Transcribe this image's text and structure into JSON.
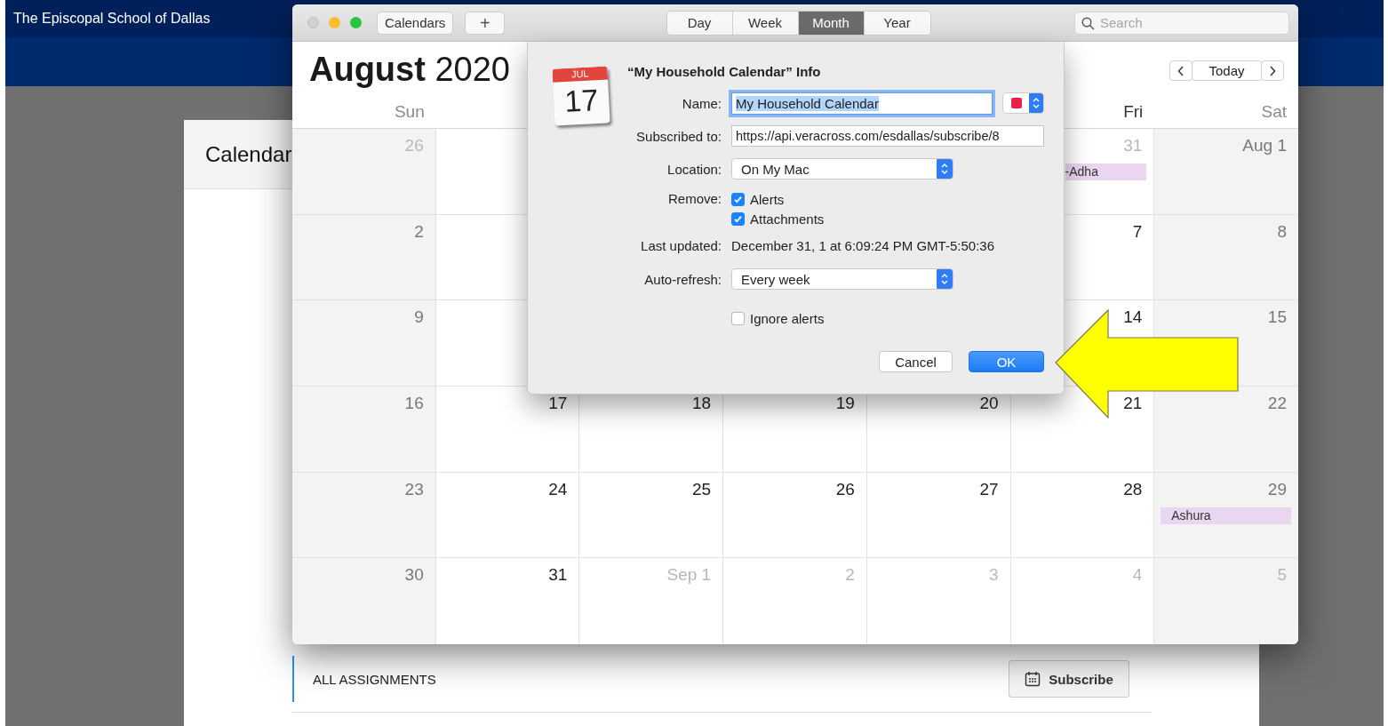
{
  "site": {
    "title": "The Episcopal School of Dallas",
    "card_title": "Calendar",
    "section_label": "ALL ASSIGNMENTS",
    "subscribe_button": "Subscribe"
  },
  "calendar_window": {
    "toolbar": {
      "calendars_button": "Calendars",
      "add_button": "+",
      "views": [
        {
          "label": "Day",
          "selected": false
        },
        {
          "label": "Week",
          "selected": false
        },
        {
          "label": "Month",
          "selected": true
        },
        {
          "label": "Year",
          "selected": false
        }
      ],
      "search": {
        "placeholder": "Search"
      }
    },
    "title": "**August** 2020",
    "today_button": "Today",
    "day_headers": {
      "start": [
        "Sun"
      ],
      "end": [
        "Fri",
        "Sat"
      ]
    },
    "weeks": [
      {
        "start": [
          {
            "label": "26",
            "other_month": true
          }
        ],
        "end": [
          {
            "label": "31",
            "other_month": true,
            "events": [
              "-Adha"
            ]
          },
          {
            "label": "Aug 1",
            "other_month": false
          }
        ]
      },
      {
        "start": [
          {
            "label": "2",
            "other_month": false
          }
        ],
        "end": [
          {
            "label": "7",
            "other_month": false
          },
          {
            "label": "8",
            "other_month": false
          }
        ]
      },
      {
        "start": [
          {
            "label": "9",
            "other_month": false
          }
        ],
        "end": [
          {
            "label": "14",
            "other_month": false
          },
          {
            "label": "15",
            "other_month": false
          }
        ]
      },
      {
        "start": [
          {
            "label": "16",
            "other_month": false
          },
          {
            "label": "17",
            "other_month": false
          },
          {
            "label": "18",
            "other_month": false
          },
          {
            "label": "19",
            "other_month": false
          },
          {
            "label": "20",
            "other_month": false
          },
          {
            "label": "21",
            "other_month": false
          },
          {
            "label": "22",
            "other_month": false
          }
        ]
      },
      {
        "start": [
          {
            "label": "23",
            "other_month": false
          },
          {
            "label": "24",
            "other_month": false
          },
          {
            "label": "25",
            "other_month": false
          },
          {
            "label": "26",
            "other_month": false
          },
          {
            "label": "27",
            "other_month": false
          },
          {
            "label": "28",
            "other_month": false
          },
          {
            "label": "29",
            "other_month": false,
            "events": [
              "Ashura"
            ]
          }
        ]
      },
      {
        "start": [
          {
            "label": "30",
            "other_month": false
          },
          {
            "label": "31",
            "other_month": false
          },
          {
            "label": "Sep 1",
            "other_month": true
          },
          {
            "label": "2",
            "other_month": true
          },
          {
            "label": "3",
            "other_month": true
          },
          {
            "label": "4",
            "other_month": true
          },
          {
            "label": "5",
            "other_month": true
          }
        ]
      }
    ]
  },
  "dialog": {
    "icon": {
      "month": "JUL",
      "day": "17"
    },
    "title": "“My Household Calendar” Info",
    "name": {
      "label": "Name:",
      "value": "My Household Calendar",
      "text_selected": true,
      "color": "#e8234a"
    },
    "subscribed": {
      "label": "Subscribed to:",
      "value": "https://api.veracross.com/esdallas/subscribe/8"
    },
    "location": {
      "label": "Location:",
      "value": "On My Mac"
    },
    "remove": {
      "label": "Remove:",
      "options": [
        {
          "label": "Alerts",
          "checked": true
        },
        {
          "label": "Attachments",
          "checked": true
        }
      ]
    },
    "last_updated": {
      "label": "Last updated:",
      "value": "December 31, 1 at 6:09:24 PM GMT-5:50:36"
    },
    "auto_refresh": {
      "label": "Auto-refresh:",
      "value": "Every week"
    },
    "ignore_alerts": {
      "label": "Ignore alerts",
      "checked": false
    },
    "buttons": {
      "cancel": "Cancel",
      "ok": "OK"
    }
  }
}
